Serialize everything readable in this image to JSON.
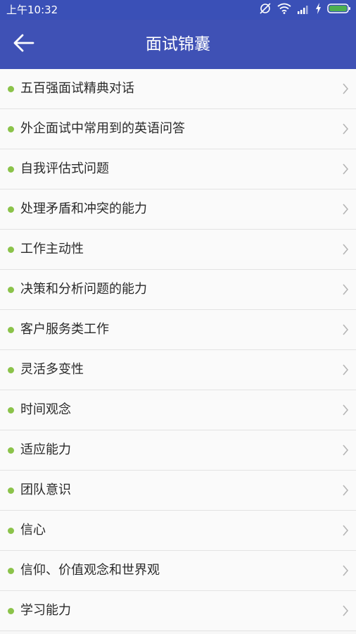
{
  "status_bar": {
    "time": "上午10:32",
    "icons": [
      "sync-off-icon",
      "wifi-icon",
      "signal-icon",
      "charging-icon",
      "battery-icon"
    ]
  },
  "app_bar": {
    "back_icon": "arrow-left-icon",
    "title": "面试锦囊"
  },
  "topics": [
    {
      "label": "五百强面试精典对话"
    },
    {
      "label": "外企面试中常用到的英语问答"
    },
    {
      "label": "自我评估式问题"
    },
    {
      "label": "处理矛盾和冲突的能力"
    },
    {
      "label": "工作主动性"
    },
    {
      "label": "决策和分析问题的能力"
    },
    {
      "label": "客户服务类工作"
    },
    {
      "label": "灵活多变性"
    },
    {
      "label": "时间观念"
    },
    {
      "label": "适应能力"
    },
    {
      "label": "团队意识"
    },
    {
      "label": "信心"
    },
    {
      "label": "信仰、价值观念和世界观"
    },
    {
      "label": "学习能力"
    }
  ],
  "colors": {
    "status_bar": "#3a50b7",
    "app_bar": "#3f51b5",
    "bullet": "#8bc34a",
    "battery": "#4caf50"
  }
}
